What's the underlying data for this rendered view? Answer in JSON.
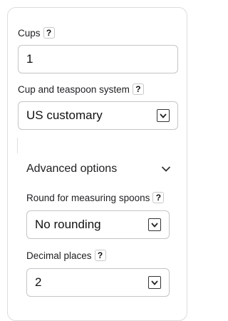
{
  "cups": {
    "label": "Cups",
    "help": "?",
    "value": "1"
  },
  "system": {
    "label": "Cup and teaspoon system",
    "help": "?",
    "selected": "US customary"
  },
  "advanced": {
    "title": "Advanced options",
    "rounding": {
      "label": "Round for measuring spoons",
      "help": "?",
      "selected": "No rounding"
    },
    "decimals": {
      "label": "Decimal places",
      "help": "?",
      "selected": "2"
    }
  }
}
